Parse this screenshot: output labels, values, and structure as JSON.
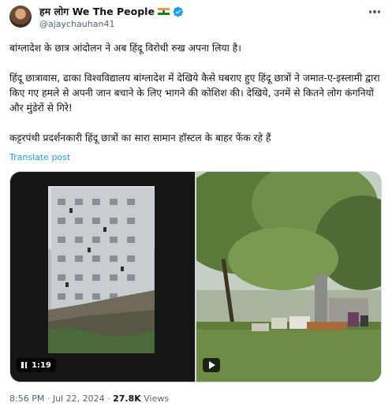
{
  "author": {
    "display_name": "हम लोग We The People",
    "handle": "@ajaychauhan41",
    "flag_colors": [
      "#ff9933",
      "#ffffff",
      "#138808"
    ],
    "verified_color": "#1d9bf0"
  },
  "tweet": {
    "paragraph_1": "बांग्लादेश के छात्र आंदोलन ने अब हिंदू विरोधी रुख अपना लिया है।",
    "paragraph_2": "हिंदू छात्रावास, ढाका विश्वविद्यालय बांग्लादेश में देखिये कैसे घबराए हुए हिंदू छात्रों ने जमात-ए-इस्लामी द्वारा किए गए हमले से अपनी जान बचाने के लिए भागने की कोशिश की। देखिये, उनमें से कितने लोग कंगनियों और मुंडेरों से गिरे!",
    "paragraph_3": "कट्टरपंथी प्रदर्शनकारी हिंदू छात्रों का सारा सामान हॉस्टल के बाहर फेंक रहे हैं",
    "translate_label": "Translate post"
  },
  "media": {
    "video_1_duration": "1:19",
    "video_1_icon": "pause-icon",
    "video_2_icon": "play-icon"
  },
  "meta": {
    "time": "8:56 PM",
    "separator": "·",
    "date": "Jul 22, 2024",
    "views_count": "27.8K",
    "views_label": "Views"
  }
}
